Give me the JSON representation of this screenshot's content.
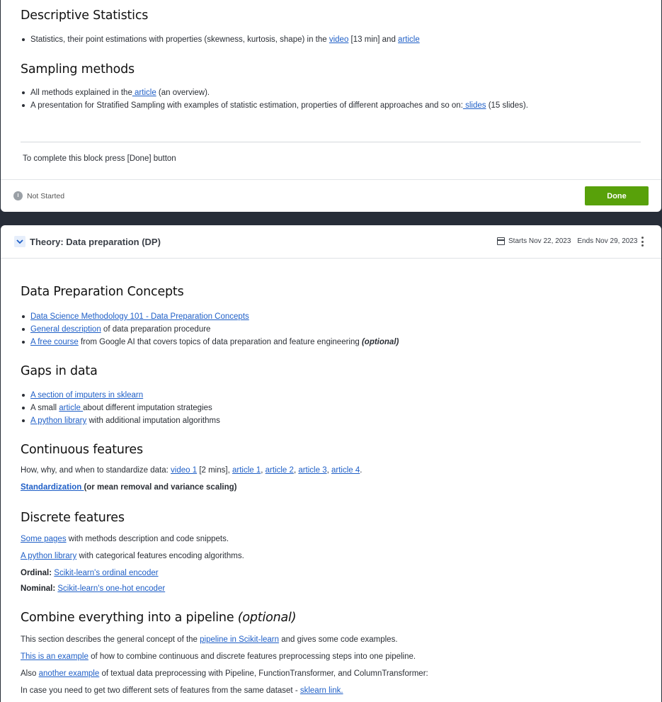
{
  "block1": {
    "h_desc": "Descriptive Statistics",
    "desc": {
      "t1": "Statistics, their point estimations with properties (skewness, kurtosis, shape) in the ",
      "link1": "video",
      "t2": " [13 min] and ",
      "link2": "article"
    },
    "h_sampling": "Sampling methods",
    "s1": {
      "t1": "All methods explained in the",
      "link": " article",
      "t2": " (an overview)."
    },
    "s2": {
      "t1": "A presentation for Stratified Sampling with examples of statistic estimation, properties of different approaches and so on:",
      "link": " slides",
      "t2": " (15 slides)."
    },
    "complete_text": "To complete this block press [Done] button",
    "status": "Not Started",
    "done_label": "Done"
  },
  "block2": {
    "header_title": "Theory: Data preparation (DP)",
    "starts": "Starts Nov 22, 2023",
    "ends": "Ends Nov 29, 2023",
    "h_concepts": "Data Preparation Concepts",
    "c1": {
      "link": "Data Science Methodology 101 - Data Preparation Concepts "
    },
    "c2": {
      "link": "General description",
      "t": " of data preparation procedure"
    },
    "c3": {
      "link": "A free course",
      "t": " from Google AI that covers topics of data preparation and feature engineering ",
      "em": "(optional)"
    },
    "h_gaps": "Gaps in data",
    "g1": {
      "link": "A section of imputers in sklearn"
    },
    "g2": {
      "t1": "A small ",
      "link": "article ",
      "t2": "about different imputation strategies"
    },
    "g3": {
      "link": "A python library",
      "t": " with additional imputation algorithms"
    },
    "h_cont": "Continuous features",
    "cont1": {
      "t1": "How, why, and when to standardize data: ",
      "l1": "video 1",
      "t2": " [2 mins], ",
      "l2": "article 1",
      "s1": ", ",
      "l3": "article 2",
      "s2": ", ",
      "l4": "article 3",
      "s3": ", ",
      "l5": "article 4",
      "s4": "."
    },
    "cont2": {
      "link": "Standardization ",
      "t": "(or mean removal and variance scaling)"
    },
    "h_disc": "Discrete features",
    "d1": {
      "link": "Some pages",
      "t": " with methods description and code snippets."
    },
    "d2": {
      "link": "A python library",
      "t": " with categorical features encoding algorithms."
    },
    "d3": {
      "label": "Ordinal: ",
      "link": "Scikit-learn's ordinal encoder"
    },
    "d4": {
      "label": "Nominal: ",
      "link": "Scikit-learn's one-hot encoder"
    },
    "h_pipe": "Combine everything into a pipeline ",
    "h_pipe_em": "(optional)",
    "p1": {
      "t1": "This section describes the general concept of the ",
      "link": "pipeline in Scikit-learn",
      "t2": " and gives some code examples."
    },
    "p2": {
      "link": "This is an example",
      "t": " of how to combine continuous and discrete features preprocessing steps into one pipeline."
    },
    "p3": {
      "t1": "Also ",
      "link": "another example",
      "t2": " of textual data preprocessing with Pipeline, FunctionTransformer, and ColumnTransformer:"
    },
    "p4": {
      "t1": "In case you need to get two different sets of features from the same dataset - ",
      "link": "sklearn link."
    }
  }
}
